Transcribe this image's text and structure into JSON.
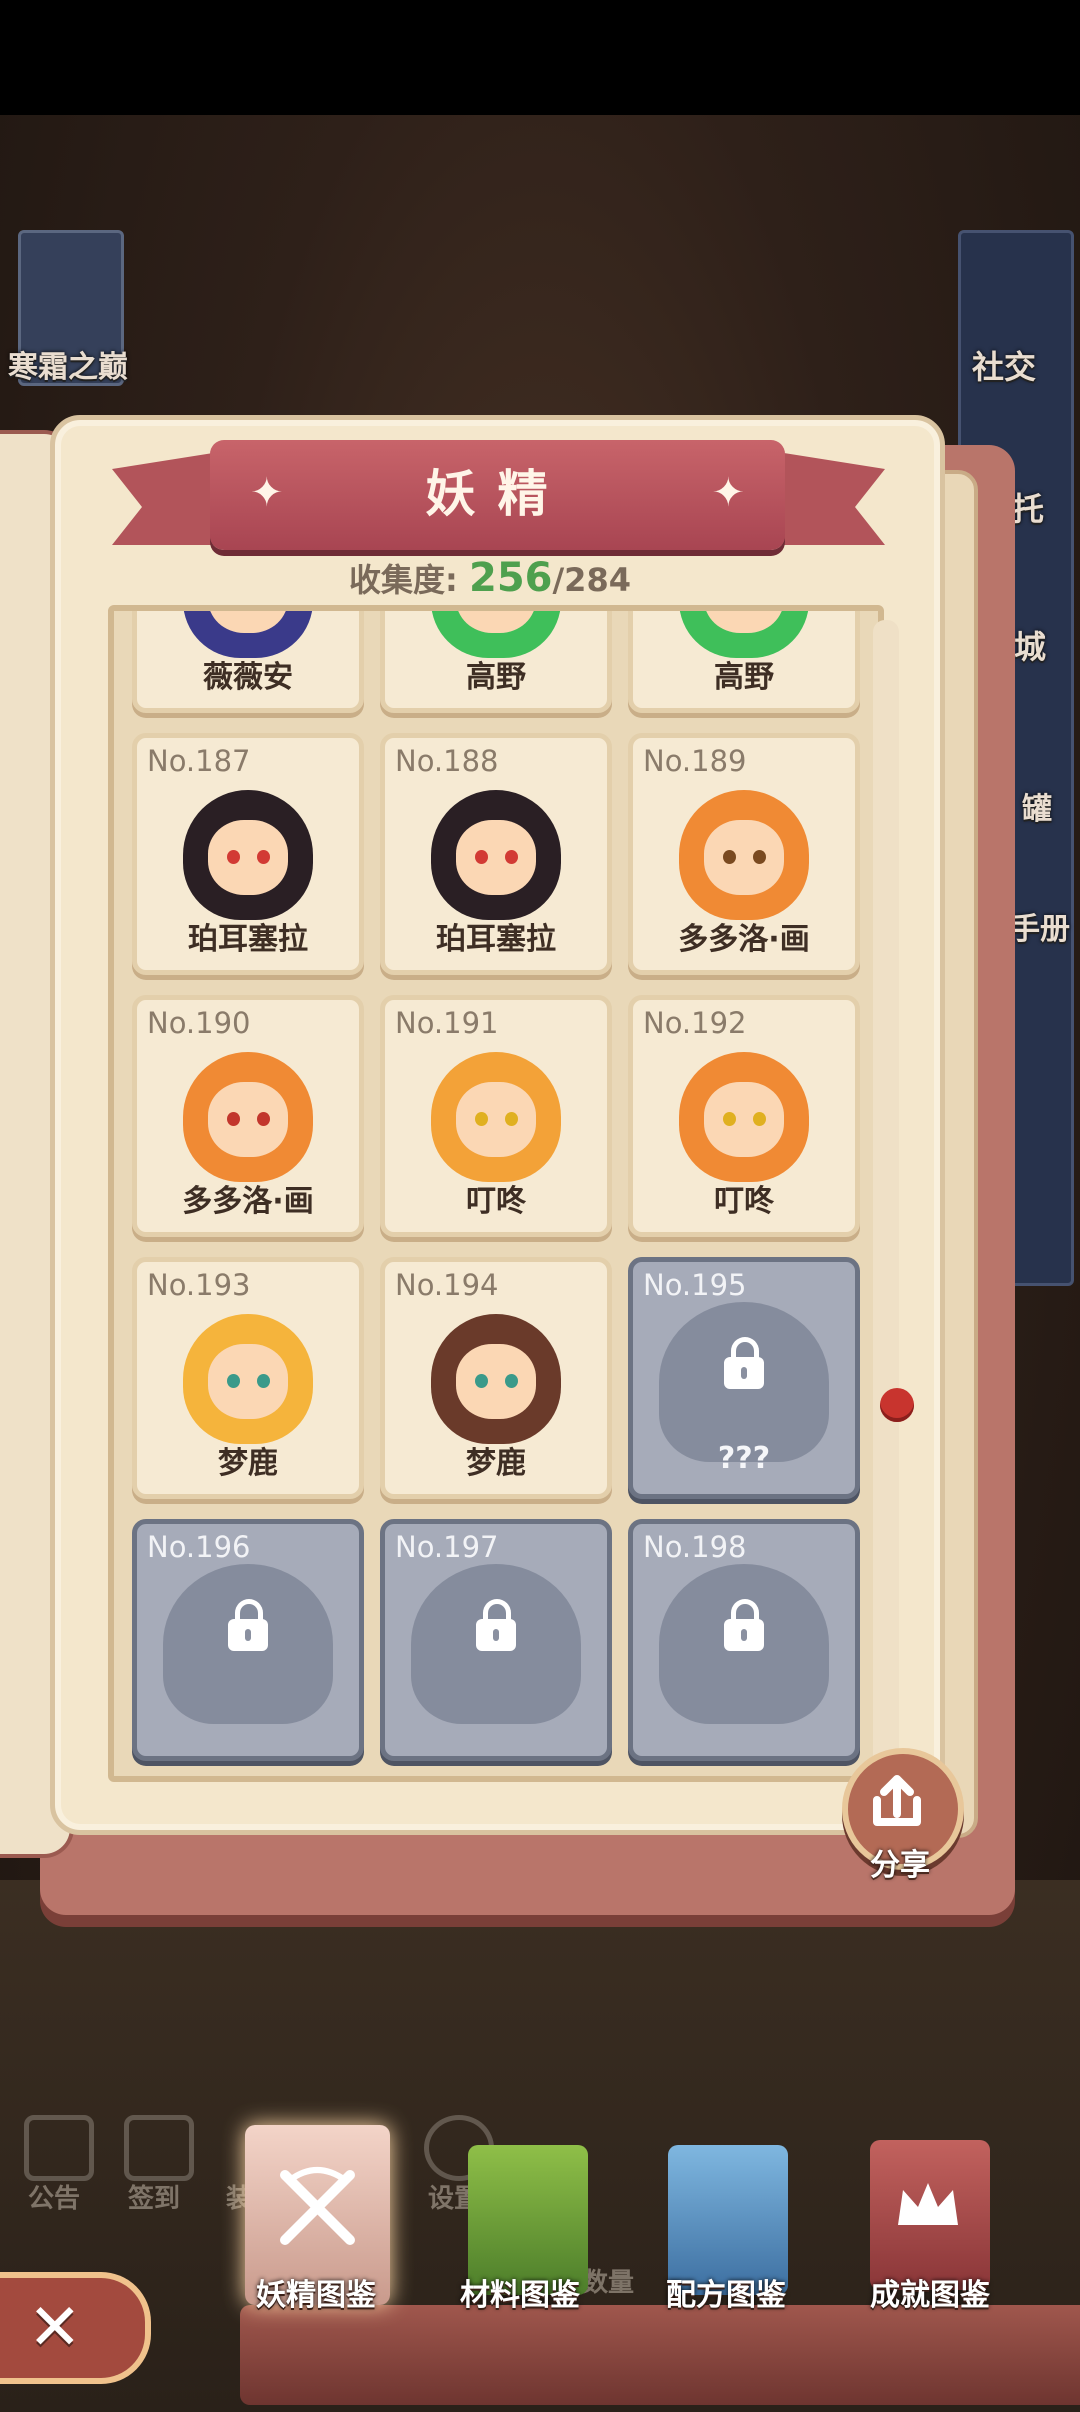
{
  "screen": {
    "title": "妖精",
    "collection_label": "收集度:",
    "collected": "256",
    "total": "/284"
  },
  "hud": {
    "left_location": "寒霜之巅",
    "right_social": "社交",
    "right_commission": "托",
    "right_city": "城",
    "right_jar": "罐",
    "right_handbook": "手册"
  },
  "cards_row0": [
    {
      "name": "薇薇安"
    },
    {
      "name": "高野"
    },
    {
      "name": "高野"
    }
  ],
  "cards": [
    {
      "no": "No.187",
      "name": "珀耳塞拉",
      "hair": "#2a1f24",
      "eye": "#d23a34"
    },
    {
      "no": "No.188",
      "name": "珀耳塞拉",
      "hair": "#2a1f24",
      "eye": "#d23a34"
    },
    {
      "no": "No.189",
      "name": "多多洛·画",
      "hair": "#f08a34",
      "eye": "#7a4a20"
    },
    {
      "no": "No.190",
      "name": "多多洛·画",
      "hair": "#f08a34",
      "eye": "#c2362c"
    },
    {
      "no": "No.191",
      "name": "叮咚",
      "hair": "#f3a238",
      "eye": "#e0b020"
    },
    {
      "no": "No.192",
      "name": "叮咚",
      "hair": "#f08a34",
      "eye": "#e0b020"
    },
    {
      "no": "No.193",
      "name": "梦鹿",
      "hair": "#f5b43c",
      "eye": "#3a9a8a"
    },
    {
      "no": "No.194",
      "name": "梦鹿",
      "hair": "#6a3a2a",
      "eye": "#3a9a8a"
    }
  ],
  "locked_cards": [
    {
      "no": "No.195",
      "name": "???"
    },
    {
      "no": "No.196",
      "name": ""
    },
    {
      "no": "No.197",
      "name": ""
    },
    {
      "no": "No.198",
      "name": ""
    }
  ],
  "share": {
    "label": "分享"
  },
  "bottom_nav": {
    "items": [
      {
        "label": "妖精图鉴",
        "active": true
      },
      {
        "label": "材料图鉴",
        "active": false
      },
      {
        "label": "配方图鉴",
        "active": false
      },
      {
        "label": "成就图鉴",
        "active": false
      }
    ]
  },
  "background_menu": {
    "notice": "公告",
    "checkin": "签到",
    "equip": "装",
    "settings": "设置",
    "quantity": "数量"
  },
  "colors": {
    "ribbon": "#b2545a",
    "page": "#f4e7cc",
    "locked": "#a6abb9",
    "progress_green": "#4ea04e"
  }
}
